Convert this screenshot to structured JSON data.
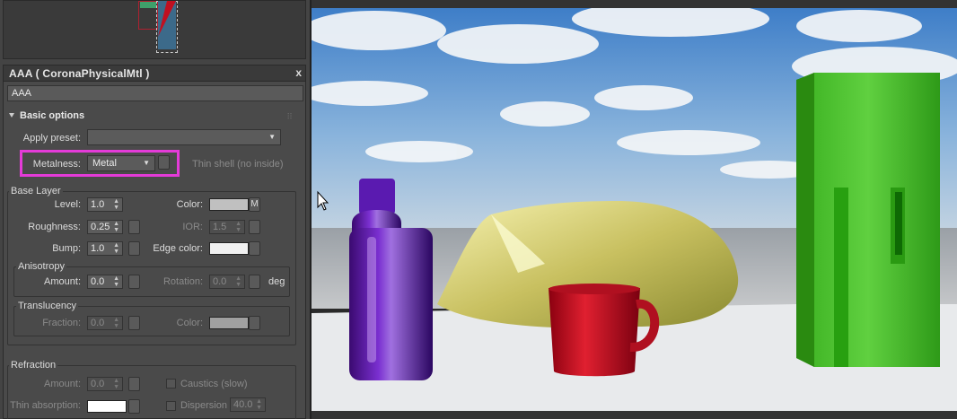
{
  "panel": {
    "title": "AAA  ( CoronaPhysicalMtl )",
    "close": "x",
    "material_name": "AAA"
  },
  "basic_options": {
    "header": "Basic options",
    "apply_preset_label": "Apply preset:",
    "apply_preset_value": "",
    "metalness_label": "Metalness:",
    "metalness_value": "Metal",
    "thin_shell_label": "Thin shell (no inside)"
  },
  "base_layer": {
    "label": "Base Layer",
    "level_label": "Level:",
    "level_value": "1.0",
    "color_label": "Color:",
    "color_map": "M",
    "roughness_label": "Roughness:",
    "roughness_value": "0.25",
    "ior_label": "IOR:",
    "ior_value": "1.5",
    "bump_label": "Bump:",
    "bump_value": "1.0",
    "edge_color_label": "Edge color:",
    "color_swatch": "#c0c0c0",
    "edge_color_swatch": "#f0f0f0"
  },
  "anisotropy": {
    "label": "Anisotropy",
    "amount_label": "Amount:",
    "amount_value": "0.0",
    "rotation_label": "Rotation:",
    "rotation_value": "0.0",
    "unit": "deg"
  },
  "translucency": {
    "label": "Translucency",
    "fraction_label": "Fraction:",
    "fraction_value": "0.0",
    "color_label": "Color:",
    "color_swatch": "#a0a0a0"
  },
  "refraction": {
    "label": "Refraction",
    "amount_label": "Amount:",
    "amount_value": "0.0",
    "caustics_label": "Caustics (slow)",
    "thin_absorption_label": "Thin absorption:",
    "dispersion_label": "Dispersion",
    "dispersion_value": "40.0",
    "thin_absorption_swatch": "#ffffff"
  },
  "colors": {
    "highlight": "#e43bd8",
    "panel_bg": "#4a4a4a"
  }
}
